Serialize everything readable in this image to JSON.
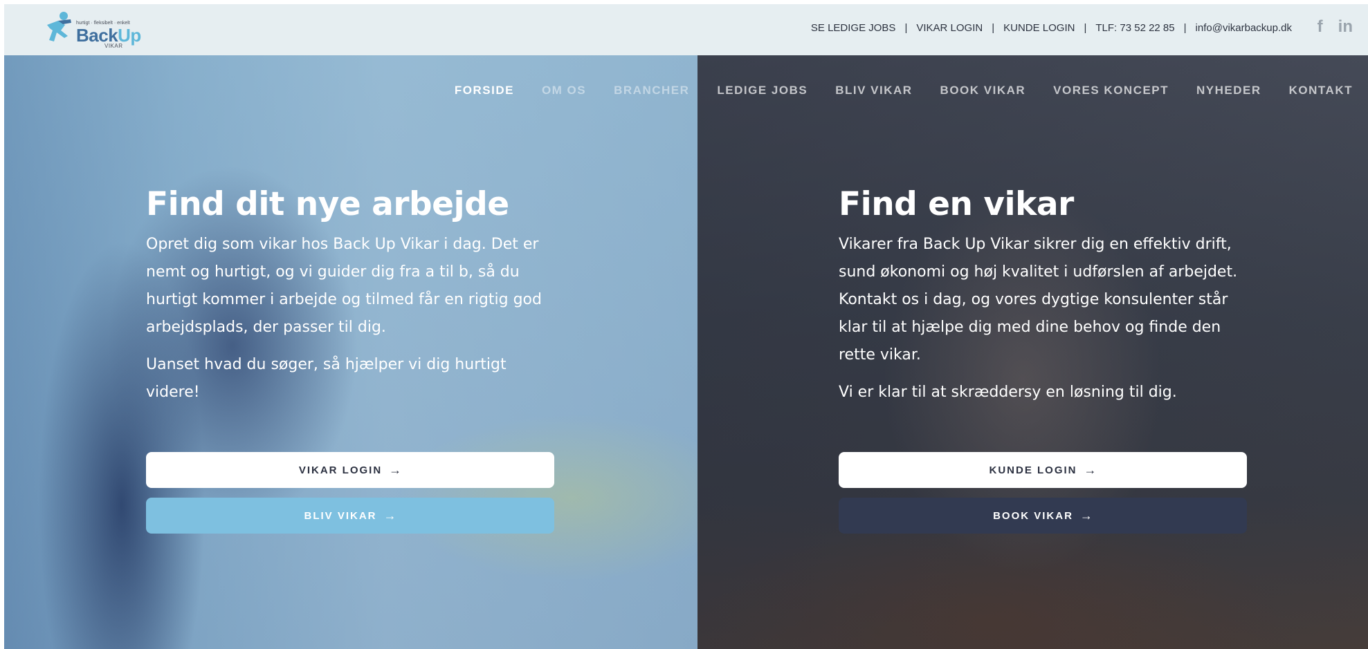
{
  "topbar": {
    "logo": {
      "tagline": "hurtigt · fleksibelt · enkelt",
      "word_back": "Back",
      "word_up": "Up",
      "sub": "VIKAR"
    },
    "links": [
      {
        "label": "SE LEDIGE JOBS"
      },
      {
        "label": "VIKAR LOGIN"
      },
      {
        "label": "KUNDE LOGIN"
      },
      {
        "label": "TLF: 73 52 22 85"
      },
      {
        "label": "info@vikarbackup.dk"
      }
    ],
    "separator": "|",
    "social": [
      {
        "icon": "facebook-icon",
        "glyph": "f"
      },
      {
        "icon": "linkedin-icon",
        "glyph": "in"
      }
    ]
  },
  "nav": {
    "items": [
      {
        "label": "FORSIDE"
      },
      {
        "label": "OM OS"
      },
      {
        "label": "BRANCHER"
      },
      {
        "label": "LEDIGE JOBS"
      },
      {
        "label": "BLIV VIKAR"
      },
      {
        "label": "BOOK VIKAR"
      },
      {
        "label": "VORES KONCEPT"
      },
      {
        "label": "NYHEDER"
      },
      {
        "label": "KONTAKT"
      }
    ]
  },
  "left": {
    "heading": "Find dit nye arbejde",
    "paragraph1": "Opret dig som vikar hos Back Up Vikar i dag. Det er nemt og hurtigt, og vi guider dig fra a til b, så du hurtigt kommer i arbejde og tilmed får en rigtig god arbejdsplads, der passer til dig.",
    "paragraph2": "Uanset hvad du søger, så hjælper vi dig hurtigt videre!",
    "button1": "VIKAR LOGIN",
    "button2": "BLIV VIKAR"
  },
  "right": {
    "heading": "Find en vikar",
    "paragraph1": "Vikarer fra Back Up Vikar sikrer dig en effektiv drift, sund økonomi og høj kvalitet i udførslen af arbejdet. Kontakt os i dag, og vores dygtige konsulenter står klar til at hjælpe dig med dine behov og finde den rette vikar.",
    "paragraph2": "Vi er klar til at skræddersy en løsning til dig.",
    "button1": "KUNDE LOGIN",
    "button2": "BOOK VIKAR"
  },
  "arrow": "→",
  "colors": {
    "topbar_bg": "#e6eef1",
    "logo_dark": "#3f6f9e",
    "logo_accent": "#5eb7d9",
    "button_blue": "#7ec0e0",
    "button_navy": "#323a51"
  }
}
